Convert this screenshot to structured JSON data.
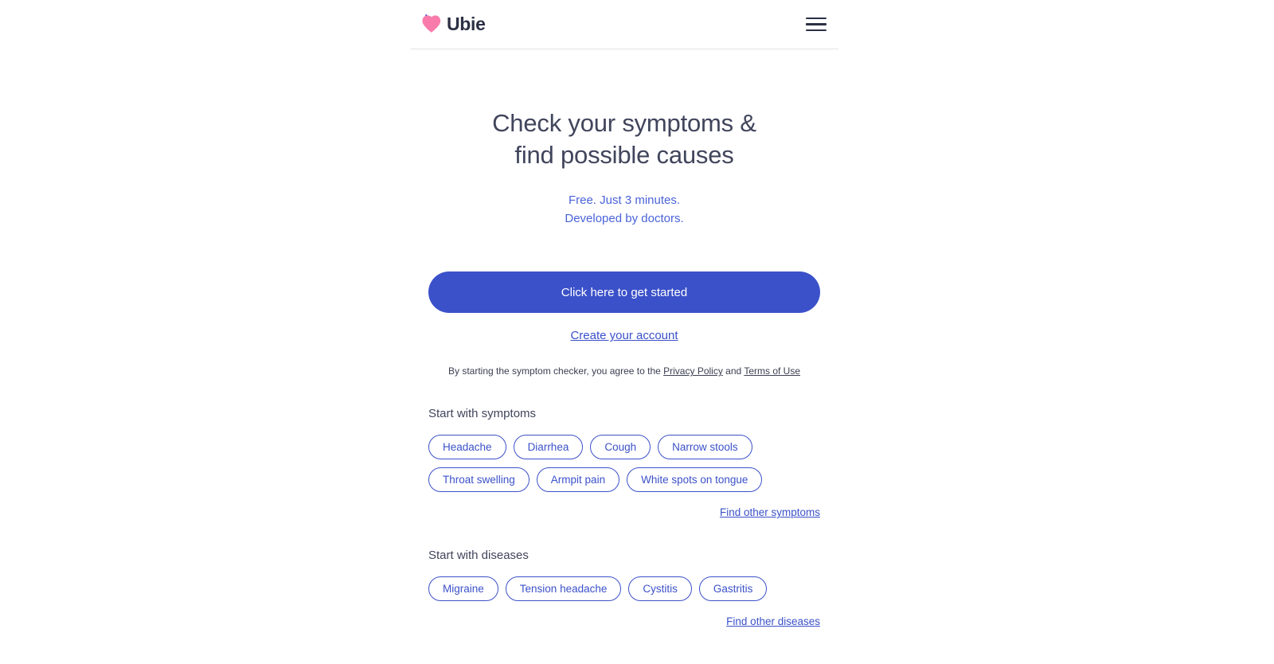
{
  "header": {
    "brand_name": "Ubie",
    "logo_icon": "heart-logo-icon",
    "menu_icon": "hamburger-menu-icon",
    "colors": {
      "heart_pink": "#f97bac",
      "heart_blue": "#2b3fc4",
      "brand_text": "#2c3044"
    }
  },
  "hero": {
    "title_line1": "Check your symptoms &",
    "title_line2": "find possible causes",
    "subtitle_line1": "Free. Just 3 minutes.",
    "subtitle_line2": "Developed by doctors.",
    "cta_label": "Click here to get started",
    "account_link": "Create your account",
    "legal_prefix": "By starting the symptom checker, you agree to the ",
    "legal_privacy": "Privacy Policy",
    "legal_middle": " and ",
    "legal_terms": "Terms of Use",
    "colors": {
      "cta_background": "#3b51c9",
      "cta_text": "#ffffff",
      "subtitle": "#4a63d8",
      "title": "#41455c"
    }
  },
  "symptoms": {
    "title": "Start with symptoms",
    "chips": [
      "Headache",
      "Diarrhea",
      "Cough",
      "Narrow stools",
      "Throat swelling",
      "Armpit pain",
      "White spots on tongue"
    ],
    "find_other": "Find other symptoms"
  },
  "diseases": {
    "title": "Start with diseases",
    "chips": [
      "Migraine",
      "Tension headache",
      "Cystitis",
      "Gastritis"
    ],
    "find_other": "Find other diseases"
  }
}
